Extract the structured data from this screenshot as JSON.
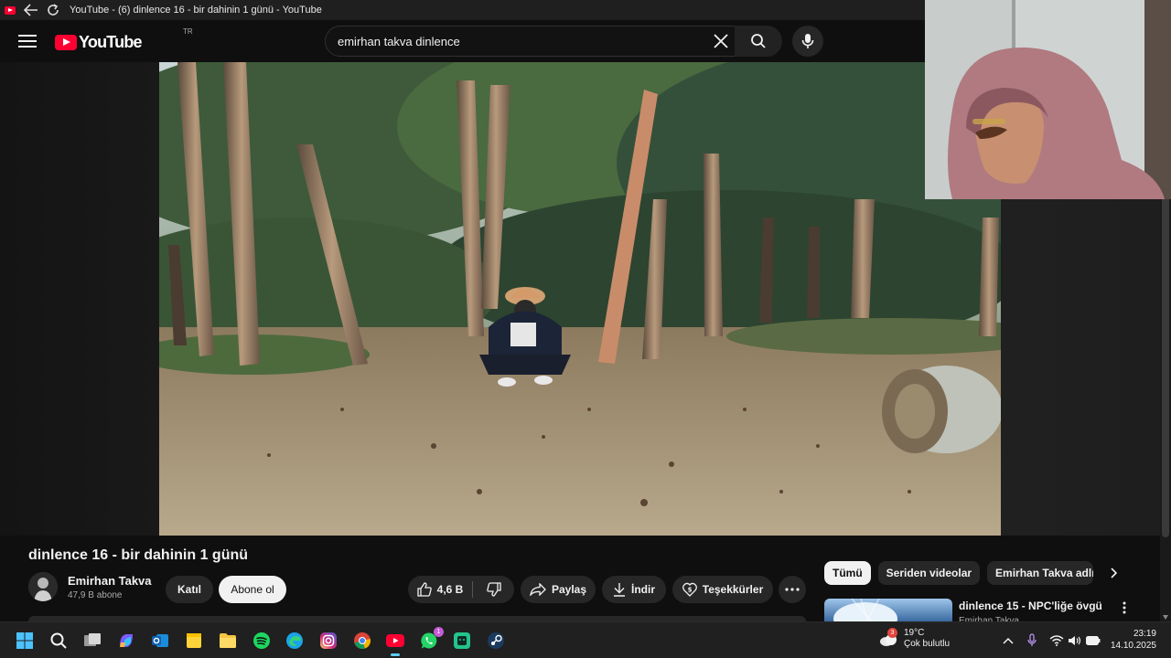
{
  "browser": {
    "window_title": "YouTube - (6) dinlence 16 - bir dahinin 1 günü - YouTube"
  },
  "masthead": {
    "logo_text": "YouTube",
    "country_code": "TR",
    "search_value": "emirhan takva dinlence"
  },
  "video": {
    "title": "dinlence 16 - bir dahinin 1 günü",
    "channel_name": "Emirhan Takva",
    "subscribers": "47,9 B abone",
    "join_label": "Katıl",
    "subscribe_label": "Abone ol",
    "likes": "4,6 B",
    "share_label": "Paylaş",
    "download_label": "İndir",
    "thanks_label": "Teşekkürler"
  },
  "chips": [
    {
      "label": "Tümü",
      "active": true
    },
    {
      "label": "Seriden videolar",
      "active": false
    },
    {
      "label": "Emirhan Takva adlı y",
      "active": false
    }
  ],
  "recommendation": {
    "title": "dinlence 15 - NPC'liğe övgü",
    "channel": "Emirhan Takva"
  },
  "taskbar": {
    "weather_temp": "19°C",
    "weather_desc": "Çok bulutlu",
    "weather_badge": "3",
    "whatsapp_badge": "1",
    "time": "23:19",
    "date": "14.10.2025",
    "icons": [
      "windows-start-icon",
      "search-icon",
      "task-view-icon",
      "copilot-icon",
      "outlook-icon",
      "sticky-notes-icon",
      "file-explorer-icon",
      "spotify-icon",
      "edge-icon",
      "instagram-icon",
      "chrome-icon",
      "youtube-app-icon",
      "whatsapp-icon",
      "bluestacks-icon",
      "steam-icon"
    ]
  },
  "colors": {
    "brand_red": "#ff0033",
    "background": "#0f0f0f",
    "chip_bg": "#272727",
    "taskbar_accent": "#60cdff"
  }
}
